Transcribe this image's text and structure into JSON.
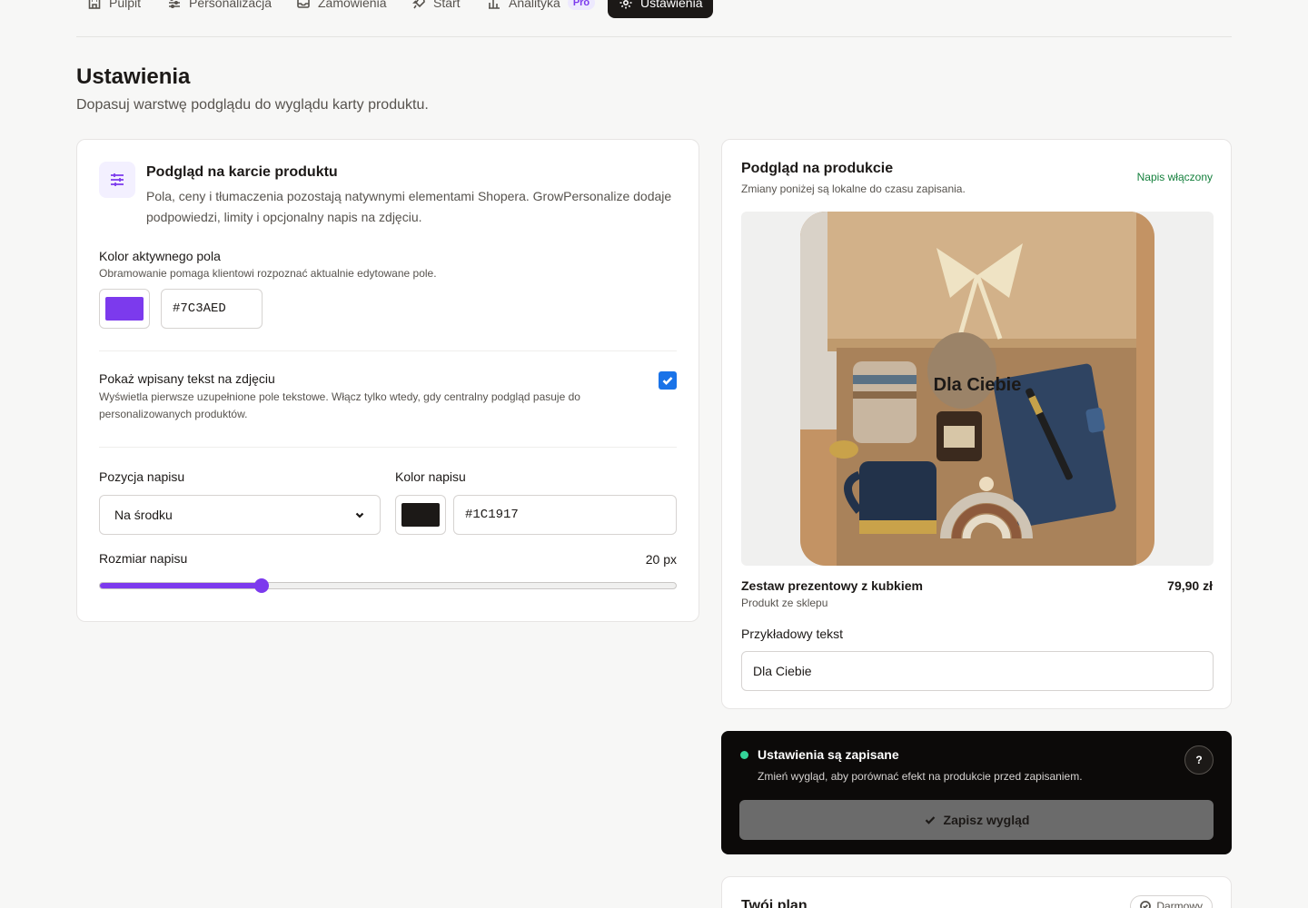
{
  "nav": {
    "items": [
      {
        "label": "Pulpit",
        "icon": "building-icon"
      },
      {
        "label": "Personalizacja",
        "icon": "sliders-icon"
      },
      {
        "label": "Zamówienia",
        "icon": "inbox-icon"
      },
      {
        "label": "Start",
        "icon": "rocket-icon"
      },
      {
        "label": "Analityka",
        "icon": "bar-chart-icon",
        "badge": "Pro"
      },
      {
        "label": "Ustawienia",
        "icon": "gear-icon",
        "active": true
      }
    ]
  },
  "header": {
    "title": "Ustawienia",
    "subtitle": "Dopasuj warstwę podglądu do wyglądu karty produktu."
  },
  "settings": {
    "section_title": "Podgląd na karcie produktu",
    "section_desc": "Pola, ceny i tłumaczenia pozostają natywnymi elementami Shopera. GrowPersonalize dodaje podpowiedzi, limity i opcjonalny napis na zdjęciu.",
    "active_color": {
      "label": "Kolor aktywnego pola",
      "hint": "Obramowanie pomaga klientowi rozpoznać aktualnie edytowane pole.",
      "value": "#7C3AED"
    },
    "show_text": {
      "label": "Pokaż wpisany tekst na zdjęciu",
      "hint": "Wyświetla pierwsze uzupełnione pole tekstowe. Włącz tylko wtedy, gdy centralny podgląd pasuje do personalizowanych produktów.",
      "checked": true
    },
    "position": {
      "label": "Pozycja napisu",
      "value": "Na środku"
    },
    "text_color": {
      "label": "Kolor napisu",
      "value": "#1C1917"
    },
    "text_size": {
      "label": "Rozmiar napisu",
      "value_label": "20 px",
      "fraction": 0.28
    }
  },
  "preview": {
    "title": "Podgląd na produkcie",
    "subtitle": "Zmiany poniżej są lokalne do czasu zapisania.",
    "status": "Napis włączony",
    "overlay_text": "Dla Ciebie",
    "product_name": "Zestaw prezentowy z kubkiem",
    "product_price": "79,90 zł",
    "product_source": "Produkt ze sklepu",
    "sample_label": "Przykładowy tekst",
    "sample_value": "Dla Ciebie"
  },
  "save_panel": {
    "title": "Ustawienia są zapisane",
    "desc": "Zmień wygląd, aby porównać efekt na produkcie przed zapisaniem.",
    "help": "?",
    "button": "Zapisz wygląd"
  },
  "plan": {
    "title": "Twój plan",
    "badge": "Darmowy"
  }
}
